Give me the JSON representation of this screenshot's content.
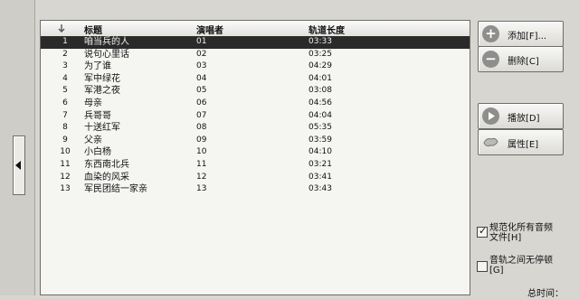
{
  "columns": {
    "title": "标题",
    "singer": "演唱者",
    "length": "轨道长度"
  },
  "tracks": [
    {
      "num": "1",
      "title": "咱当兵的人",
      "singer": "01",
      "length": "03:33",
      "selected": true
    },
    {
      "num": "2",
      "title": "说句心里话",
      "singer": "02",
      "length": "03:25"
    },
    {
      "num": "3",
      "title": "为了谁",
      "singer": "03",
      "length": "04:29"
    },
    {
      "num": "4",
      "title": "军中绿花",
      "singer": "04",
      "length": "04:01"
    },
    {
      "num": "5",
      "title": "军港之夜",
      "singer": "05",
      "length": "03:08"
    },
    {
      "num": "6",
      "title": "母亲",
      "singer": "06",
      "length": "04:56"
    },
    {
      "num": "7",
      "title": "兵哥哥",
      "singer": "07",
      "length": "04:04"
    },
    {
      "num": "8",
      "title": "十送红军",
      "singer": "08",
      "length": "05:35"
    },
    {
      "num": "9",
      "title": "父亲",
      "singer": "09",
      "length": "03:59"
    },
    {
      "num": "10",
      "title": "小白杨",
      "singer": "10",
      "length": "04:10"
    },
    {
      "num": "11",
      "title": "东西南北兵",
      "singer": "11",
      "length": "03:21"
    },
    {
      "num": "12",
      "title": "血染的风采",
      "singer": "12",
      "length": "03:41"
    },
    {
      "num": "13",
      "title": "军民团结一家亲",
      "singer": "13",
      "length": "03:43"
    }
  ],
  "buttons": {
    "add": {
      "label": "添加[F]...",
      "icon": "plus-icon"
    },
    "remove": {
      "label": "删除[C]",
      "icon": "minus-icon"
    },
    "play": {
      "label": "播放[D]",
      "icon": "play-icon"
    },
    "properties": {
      "label": "属性[E]",
      "icon": "properties-icon"
    }
  },
  "options": {
    "normalize": {
      "label_line1": "规范化所有音频",
      "label_line2": "文件[H]",
      "checked": true
    },
    "no_gap": {
      "label_line1": "音轨之间无停顿",
      "label_line2": "[G]",
      "checked": false
    }
  },
  "total_label": "总时间："
}
